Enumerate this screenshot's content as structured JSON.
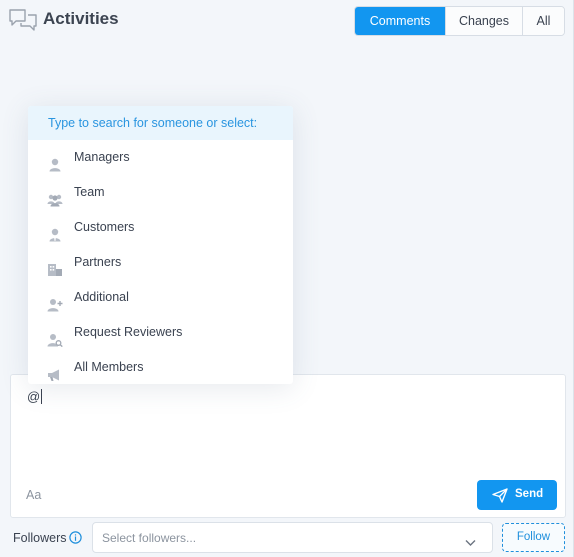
{
  "header": {
    "title": "Activities",
    "icon": "chat-bubbles-icon",
    "tabs": [
      {
        "label": "Comments",
        "active": true
      },
      {
        "label": "Changes",
        "active": false
      },
      {
        "label": "All",
        "active": false
      }
    ]
  },
  "mention_menu": {
    "prompt": "Type to search for someone or select:",
    "items": [
      {
        "label": "Managers",
        "icon": "user-icon"
      },
      {
        "label": "Team",
        "icon": "team-icon"
      },
      {
        "label": "Customers",
        "icon": "customer-icon"
      },
      {
        "label": "Partners",
        "icon": "partners-icon"
      },
      {
        "label": "Additional",
        "icon": "user-add-icon"
      },
      {
        "label": "Request Reviewers",
        "icon": "user-search-icon"
      },
      {
        "label": "All Members",
        "icon": "megaphone-icon"
      }
    ]
  },
  "composer": {
    "text": "@",
    "format_toggle": "Aa",
    "send_label": "Send"
  },
  "followers": {
    "label": "Followers",
    "placeholder": "Select followers...",
    "follow_label": "Follow"
  },
  "colors": {
    "accent": "#1296f0",
    "background": "#f3f6fa",
    "menu_prompt_bg": "#e9f5fd",
    "icon_gray": "#b6bcc6"
  }
}
